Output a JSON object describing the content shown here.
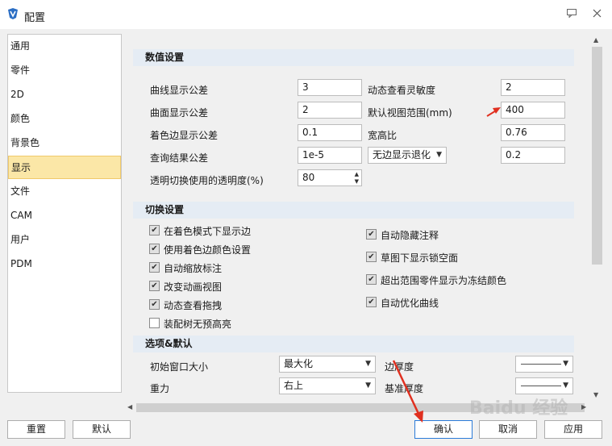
{
  "window": {
    "title": "配置",
    "help_icon": "speech-bubble-icon",
    "close_icon": "close-icon"
  },
  "nav": {
    "items": [
      "通用",
      "零件",
      "2D",
      "颜色",
      "背景色",
      "显示",
      "文件",
      "CAM",
      "用户",
      "PDM"
    ],
    "selected": "显示"
  },
  "numeric_settings": {
    "title": "数值设置",
    "rows": [
      {
        "label": "曲线显示公差",
        "value": "3",
        "label2": "动态查看灵敏度",
        "value2": "2"
      },
      {
        "label": "曲面显示公差",
        "value": "2",
        "label2": "默认视图范围(mm)",
        "value2": "400"
      },
      {
        "label": "着色边显示公差",
        "value": "0.1",
        "label2": "宽高比",
        "value2": "0.76"
      },
      {
        "label": "查询结果公差",
        "value": "1e-5",
        "label2": "无边显示退化",
        "value2": "0.2"
      }
    ],
    "transparency_label": "透明切换使用的透明度(%)",
    "transparency_value": "80"
  },
  "toggle_settings": {
    "title": "切换设置",
    "left": [
      {
        "label": "在着色模式下显示边",
        "checked": true
      },
      {
        "label": "使用着色边颜色设置",
        "checked": true
      },
      {
        "label": "自动缩放标注",
        "checked": true
      },
      {
        "label": "改变动画视图",
        "checked": true
      },
      {
        "label": "动态查看拖拽",
        "checked": true
      },
      {
        "label": "装配树无预高亮",
        "checked": false
      }
    ],
    "right": [
      {
        "label": "自动隐藏注释",
        "checked": true
      },
      {
        "label": "草图下显示锁空面",
        "checked": true
      },
      {
        "label": "超出范围零件显示为冻结颜色",
        "checked": true
      },
      {
        "label": "自动优化曲线",
        "checked": true
      }
    ]
  },
  "options": {
    "title": "选项&默认",
    "rows": [
      {
        "label": "初始窗口大小",
        "value": "最大化",
        "label2": "边厚度"
      },
      {
        "label": "重力",
        "value": "右上",
        "label2": "基准厚度"
      }
    ]
  },
  "buttons": {
    "reset": "重置",
    "default": "默认",
    "ok": "确认",
    "cancel": "取消",
    "apply": "应用"
  },
  "colors": {
    "selection": "#fbe7a7",
    "section_header": "#e5ecf4",
    "annotation_arrow": "#e03020"
  },
  "watermark": "Baidu 经验"
}
